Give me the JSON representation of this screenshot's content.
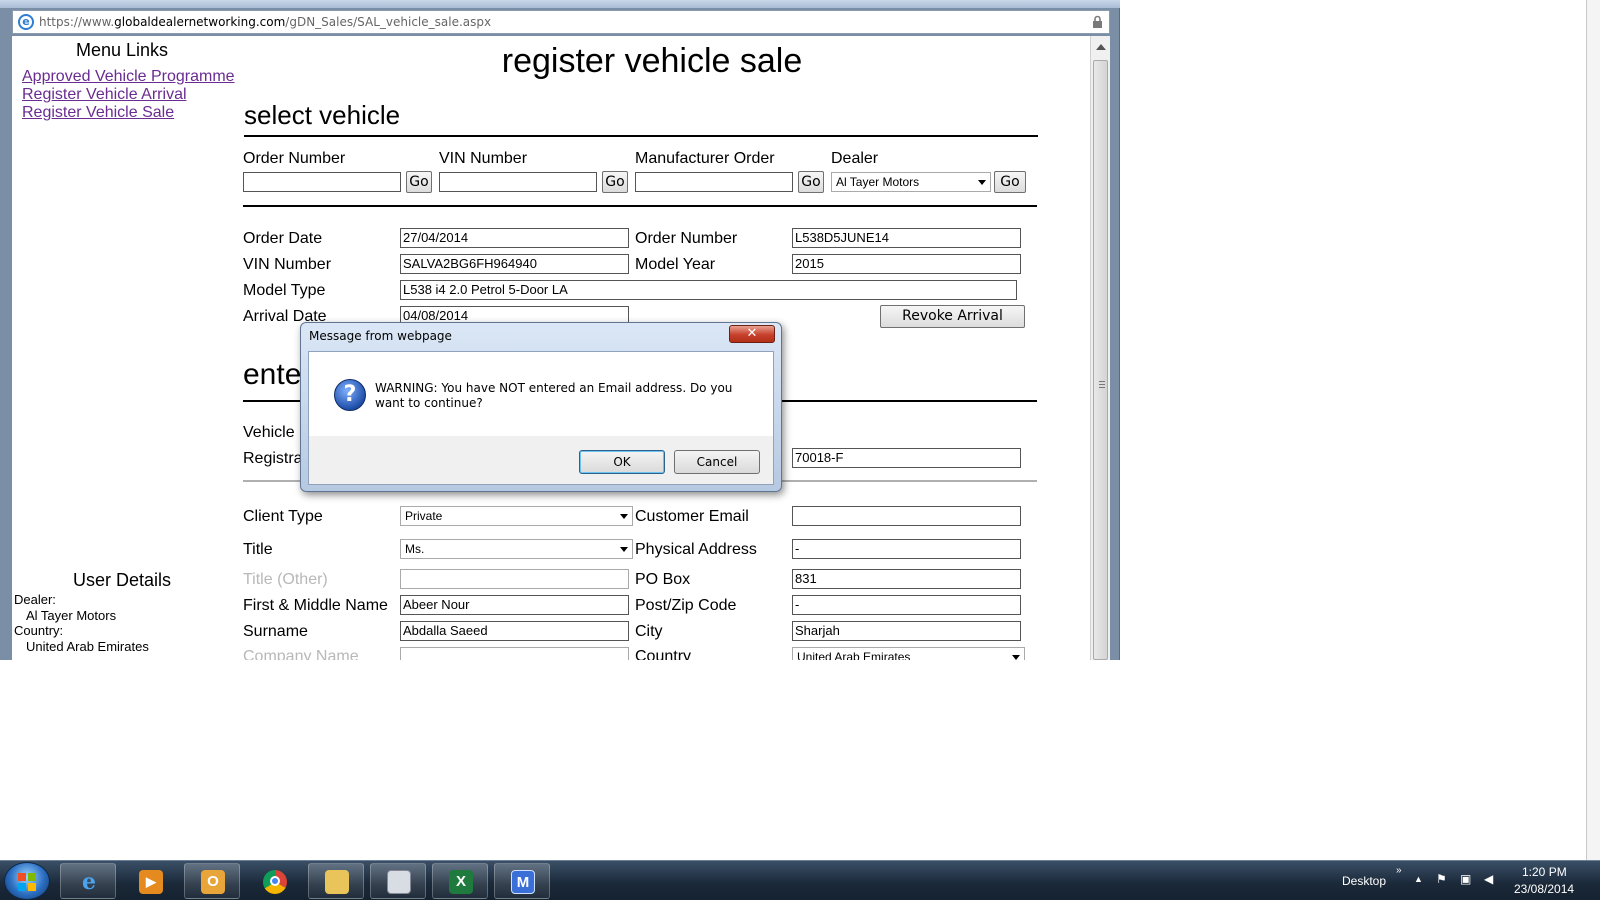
{
  "browser": {
    "url_prefix": "https://www.",
    "url_domain": "globaldealernetworking.com",
    "url_path": "/gDN_Sales/SAL_vehicle_sale.aspx"
  },
  "sidebar": {
    "menu_title": "Menu Links",
    "links": [
      "Approved Vehicle Programme",
      "Register Vehicle Arrival",
      "Register Vehicle Sale"
    ],
    "user_title": "User Details",
    "dealer_label": "Dealer:",
    "dealer_value": "Al Tayer Motors",
    "country_label": "Country:",
    "country_value": "United Arab Emirates"
  },
  "page": {
    "title": "register vehicle sale",
    "select_vehicle_title": "select vehicle",
    "enter_title": "enter",
    "search": {
      "order_number_label": "Order Number",
      "vin_number_label": "VIN Number",
      "manufacturer_order_label": "Manufacturer Order",
      "dealer_label": "Dealer",
      "dealer_selected": "Al Tayer Motors",
      "go_label": "Go"
    },
    "vehicle": {
      "order_date_label": "Order Date",
      "order_date": "27/04/2014",
      "order_number_label": "Order Number",
      "order_number": "L538D5JUNE14",
      "vin_label": "VIN Number",
      "vin": "SALVA2BG6FH964940",
      "model_year_label": "Model Year",
      "model_year": "2015",
      "model_type_label": "Model Type",
      "model_type": "L538 i4 2.0 Petrol 5-Door LA",
      "arrival_date_label": "Arrival Date",
      "arrival_date": "04/08/2014",
      "revoke_label": "Revoke Arrival"
    },
    "registration": {
      "vehicle_label": "Vehicle",
      "registration_label": "Registra",
      "plate_value": "70018-F"
    },
    "client": {
      "client_type_label": "Client Type",
      "client_type": "Private",
      "customer_email_label": "Customer Email",
      "customer_email": "",
      "title_label": "Title",
      "title": "Ms.",
      "physical_address_label": "Physical Address",
      "physical_address": "-",
      "title_other_label": "Title (Other)",
      "title_other": "",
      "po_box_label": "PO Box",
      "po_box": "831",
      "first_name_label": "First & Middle Name",
      "first_name": "Abeer Nour",
      "post_code_label": "Post/Zip Code",
      "post_code": "-",
      "surname_label": "Surname",
      "surname": "Abdalla Saeed",
      "city_label": "City",
      "city": "Sharjah",
      "company_name_label": "Company Name",
      "country_label": "Country",
      "country": "United Arab Emirates"
    }
  },
  "dialog": {
    "title": "Message from webpage",
    "message": "WARNING: You have NOT entered an Email address. Do you want to continue?",
    "ok_label": "OK",
    "cancel_label": "Cancel",
    "close_glyph": "✕",
    "icon": "question-icon"
  },
  "taskbar": {
    "apps": [
      "internet-explorer",
      "media-player",
      "outlook",
      "chrome",
      "file-explorer",
      "calculator-window",
      "excel",
      "maxthon"
    ],
    "desktop_label": "Desktop",
    "time": "1:20 PM",
    "date": "23/08/2014"
  },
  "colors": {
    "visited_link": "#6a2c91",
    "taskbar_bg": "#1a2838",
    "dialog_frame": "#b6c9e2"
  }
}
